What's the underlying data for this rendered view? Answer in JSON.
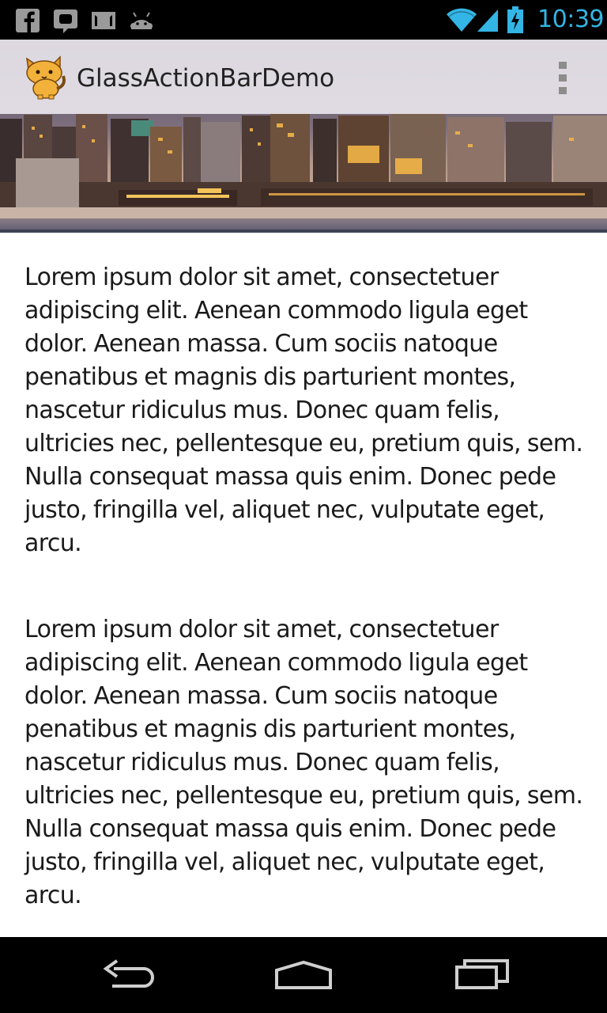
{
  "status_bar": {
    "notifications": [
      "facebook-icon",
      "talk-icon",
      "gmail-icon",
      "android-icon"
    ],
    "time": "10:39",
    "accent_color": "#33b5e5"
  },
  "action_bar": {
    "title": "GlassActionBarDemo",
    "app_icon": "cat-icon",
    "overflow_icon": "overflow-menu-icon"
  },
  "hero": {
    "image": "city-skyline-sunset"
  },
  "content": {
    "paragraphs": [
      "Lorem ipsum dolor sit amet, consectetuer adipiscing elit. Aenean commodo ligula eget dolor. Aenean massa. Cum sociis natoque penatibus et magnis dis parturient montes, nascetur ridiculus mus. Donec quam felis, ultricies nec, pellentesque eu, pretium quis, sem. Nulla consequat massa quis enim. Donec pede justo, fringilla vel, aliquet nec, vulputate eget, arcu.",
      "Lorem ipsum dolor sit amet, consectetuer adipiscing elit. Aenean commodo ligula eget dolor. Aenean massa. Cum sociis natoque penatibus et magnis dis parturient montes, nascetur ridiculus mus. Donec quam felis, ultricies nec, pellentesque eu, pretium quis, sem. Nulla consequat massa quis enim. Donec pede justo, fringilla vel, aliquet nec, vulputate eget, arcu."
    ]
  },
  "nav_bar": {
    "buttons": [
      "back-icon",
      "home-icon",
      "recent-apps-icon"
    ]
  }
}
